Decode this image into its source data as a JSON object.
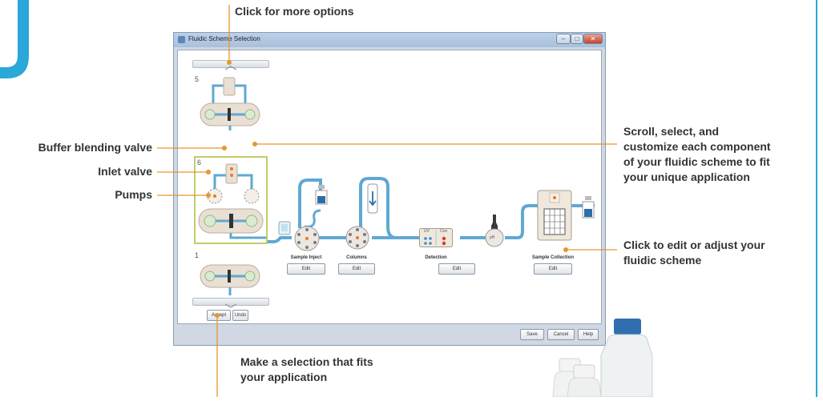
{
  "window": {
    "title": "Fluidic Scheme Selection",
    "minimize_glyph": "–",
    "maximize_glyph": "□",
    "close_glyph": "✕"
  },
  "schemes": [
    {
      "number": "5"
    },
    {
      "number": "6"
    },
    {
      "number": "1"
    }
  ],
  "components": [
    {
      "label": "Sample Inject",
      "button": "Edit"
    },
    {
      "label": "Columns",
      "button": "Edit"
    },
    {
      "label": "Detection",
      "button": "Edit"
    },
    {
      "label": "Sample Collection",
      "button": "Edit"
    }
  ],
  "detector": {
    "uv": "UV",
    "cond": "Con"
  },
  "ph_label": "pH",
  "left_buttons": {
    "accept": "Accept",
    "undo": "Undo"
  },
  "bottom_buttons": {
    "save": "Save",
    "cancel": "Cancel",
    "help": "Help"
  },
  "callouts": {
    "more_options": "Click for more options",
    "buffer_blending": "Buffer blending valve",
    "inlet_valve": "Inlet valve",
    "pumps": "Pumps",
    "scroll_select": [
      "Scroll, select, and",
      "customize each component",
      "of your fluidic scheme to fit",
      "your unique application"
    ],
    "edit_adjust": [
      "Click to edit or adjust your",
      "fluidic scheme"
    ],
    "make_selection": [
      "Make a selection that fits",
      "your application"
    ]
  },
  "colors": {
    "accent": "#29a8d9",
    "callout_line": "#e8962e",
    "tubing": "#5fa8d3",
    "selection": "#c2cc6b"
  }
}
